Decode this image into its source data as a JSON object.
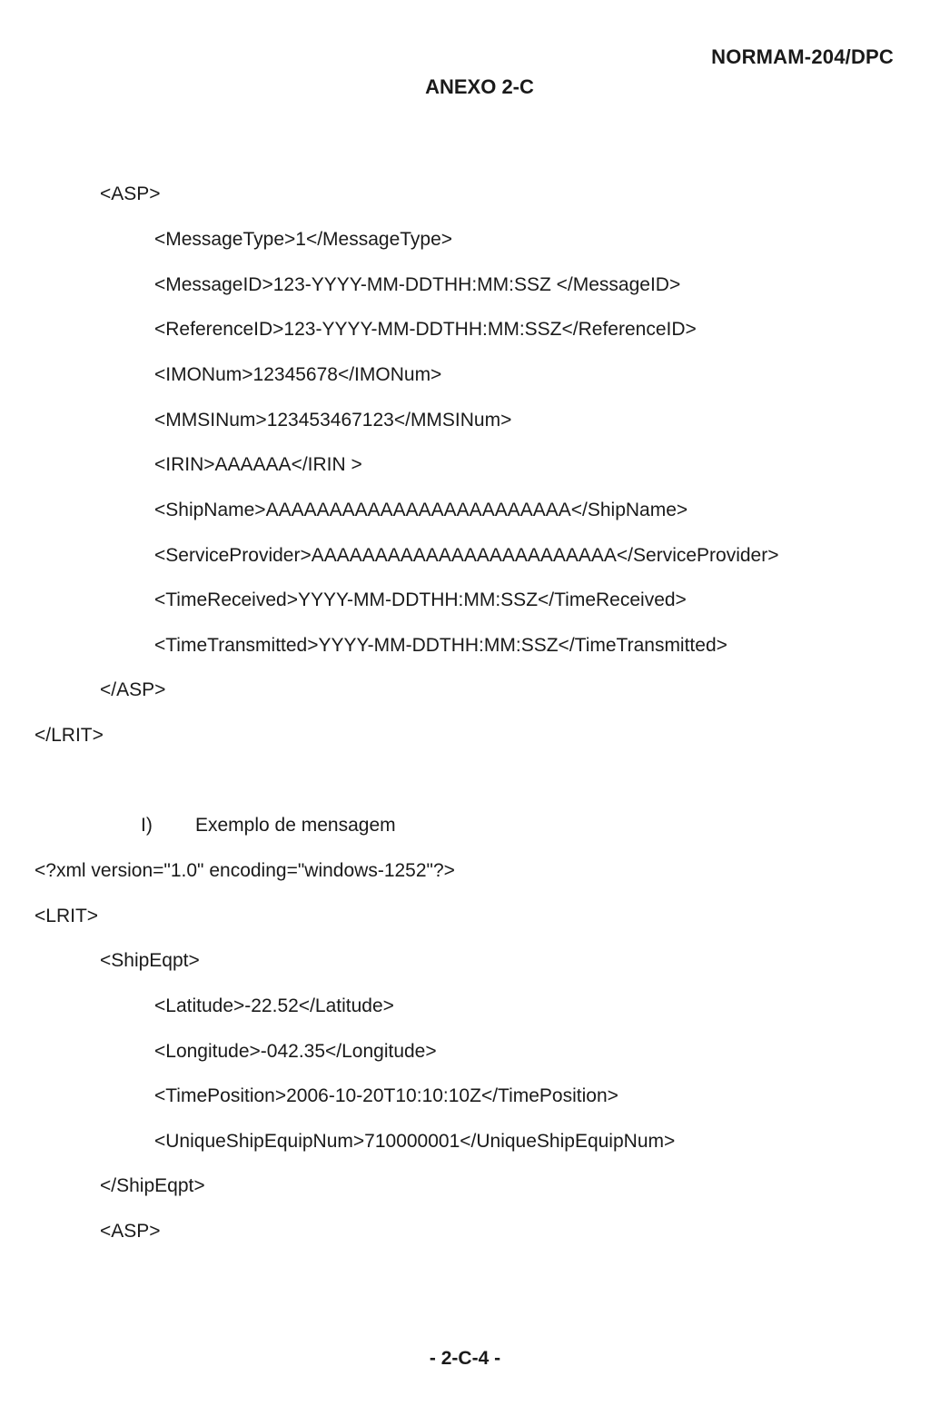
{
  "header": {
    "doc_code": "NORMAM-204/DPC",
    "annex_title": "ANEXO 2-C"
  },
  "xml_block_1": [
    {
      "text": "<ASP>",
      "indent": 1
    },
    {
      "text": "<MessageType>1</MessageType>",
      "indent": 2
    },
    {
      "text": "<MessageID>123-YYYY-MM-DDTHH:MM:SSZ </MessageID>",
      "indent": 2
    },
    {
      "text": "<ReferenceID>123-YYYY-MM-DDTHH:MM:SSZ</ReferenceID>",
      "indent": 2
    },
    {
      "text": "<IMONum>12345678</IMONum>",
      "indent": 2
    },
    {
      "text": "<MMSINum>123453467123</MMSINum>",
      "indent": 2
    },
    {
      "text": "<IRIN>AAAAAA</IRIN >",
      "indent": 2
    },
    {
      "text": "<ShipName>AAAAAAAAAAAAAAAAAAAAAAAA</ShipName>",
      "indent": 2
    },
    {
      "text": "<ServiceProvider>AAAAAAAAAAAAAAAAAAAAAAAA</ServiceProvider>",
      "indent": 2
    },
    {
      "text": "<TimeReceived>YYYY-MM-DDTHH:MM:SSZ</TimeReceived>",
      "indent": 2
    },
    {
      "text": "<TimeTransmitted>YYYY-MM-DDTHH:MM:SSZ</TimeTransmitted>",
      "indent": 2
    },
    {
      "text": "</ASP>",
      "indent": 1
    },
    {
      "text": "</LRIT>",
      "indent": 0
    }
  ],
  "section": {
    "number": "I)",
    "title": "Exemplo de mensagem"
  },
  "xml_block_2": [
    {
      "text": "<?xml version=\"1.0\" encoding=\"windows-1252\"?>",
      "indent": 0
    },
    {
      "text": "<LRIT>",
      "indent": 0
    },
    {
      "text": "<ShipEqpt>",
      "indent": 1
    },
    {
      "text": "<Latitude>-22.52</Latitude>",
      "indent": 2
    },
    {
      "text": "<Longitude>-042.35</Longitude>",
      "indent": 2
    },
    {
      "text": "<TimePosition>2006-10-20T10:10:10Z</TimePosition>",
      "indent": 2
    },
    {
      "text": "<UniqueShipEquipNum>710000001</UniqueShipEquipNum>",
      "indent": 2
    },
    {
      "text": "</ShipEqpt>",
      "indent": 1
    },
    {
      "text": "<ASP>",
      "indent": 1
    }
  ],
  "footer": {
    "page_number": "- 2-C-4 -"
  }
}
